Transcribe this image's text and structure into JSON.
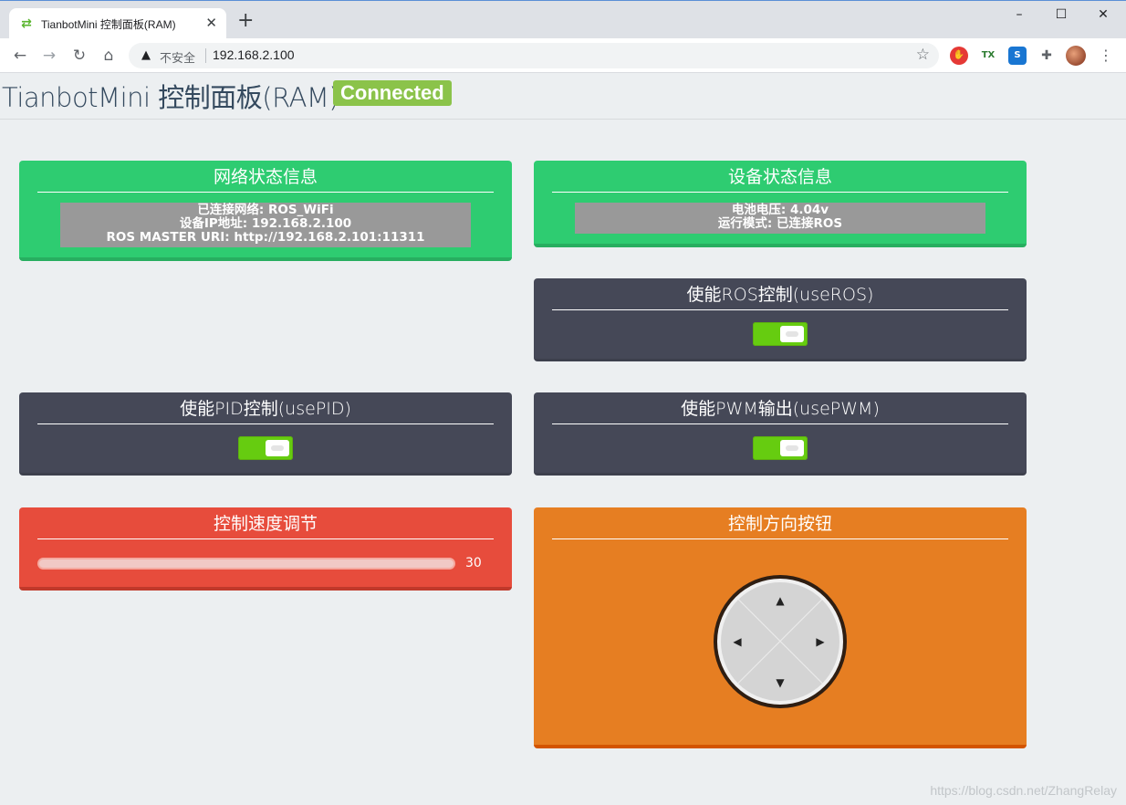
{
  "browser": {
    "tab_title": "TianbotMini 控制面板(RAM)",
    "tab_close": "✕",
    "new_tab": "+",
    "window": {
      "minimize": "–",
      "maximize": "☐",
      "close": "✕"
    },
    "security_label": "不安全",
    "url": "192.168.2.100"
  },
  "page": {
    "title": "TianbotMini 控制面板(RAM)",
    "status_badge": "Connected",
    "status_color": "#8bc34a"
  },
  "network_panel": {
    "title": "网络状态信息",
    "lines": [
      "已连接网络: ROS_WiFi",
      "设备IP地址: 192.168.2.100",
      "ROS MASTER URI: http://192.168.2.101:11311"
    ]
  },
  "device_panel": {
    "title": "设备状态信息",
    "lines": [
      "电池电压: 4.04v",
      "运行模式: 已连接ROS"
    ]
  },
  "toggles": {
    "use_ros": {
      "title": "使能ROS控制(useROS)",
      "on": true
    },
    "use_pid": {
      "title": "使能PID控制(usePID)",
      "on": true
    },
    "use_pwm": {
      "title": "使能PWM输出(usePWM)",
      "on": true
    }
  },
  "speed_panel": {
    "title": "控制速度调节",
    "value": "30"
  },
  "direction_panel": {
    "title": "控制方向按钮",
    "arrows": {
      "up": "▲",
      "down": "▼",
      "left": "◀",
      "right": "▶"
    }
  },
  "watermark": "https://blog.csdn.net/ZhangRelay",
  "colors": {
    "green": "#2ecc71",
    "dark": "#454857",
    "red": "#e74c3c",
    "orange": "#e67e22",
    "switch_on": "#66cc10"
  }
}
